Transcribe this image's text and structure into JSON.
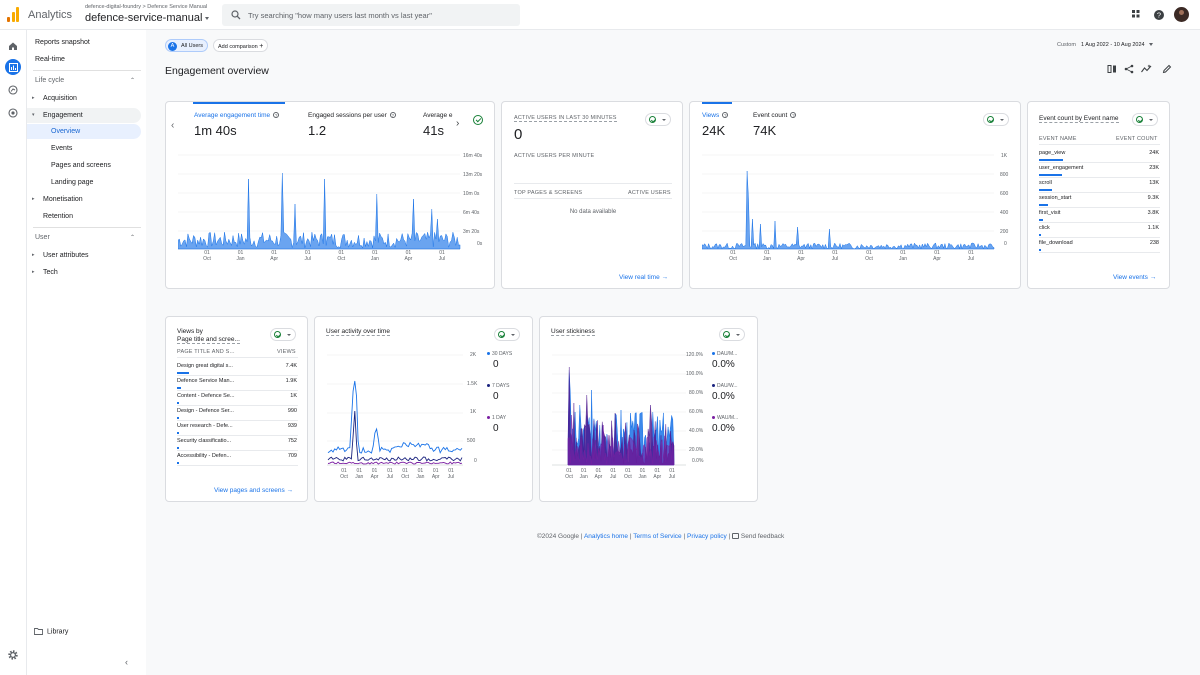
{
  "brand": {
    "app_name": "Analytics",
    "breadcrumb": "defence-digital-foundry  >  Defence Service Manual",
    "property": "defence-service-manual"
  },
  "search": {
    "placeholder": "Try searching \"how many users last month vs last year\""
  },
  "sidebar": {
    "reports_snapshot": "Reports snapshot",
    "realtime": "Real-time",
    "lifecycle_label": "Life cycle",
    "acquisition": "Acquisition",
    "engagement": "Engagement",
    "overview": "Overview",
    "events": "Events",
    "pages_screens": "Pages and screens",
    "landing_page": "Landing page",
    "monetisation": "Monetisation",
    "retention": "Retention",
    "user_label": "User",
    "user_attributes": "User attributes",
    "tech": "Tech",
    "library": "Library"
  },
  "toolbar": {
    "all_users": "All Users",
    "add_comparison": "Add comparison",
    "date_label": "Custom",
    "date_range": "1 Aug 2022 - 10 Aug 2024"
  },
  "page": {
    "title": "Engagement overview"
  },
  "main_card": {
    "metrics": [
      {
        "label": "Average engagement time",
        "value": "1m 40s"
      },
      {
        "label": "Engaged sessions per user",
        "value": "1.2"
      },
      {
        "label": "Average e",
        "value": "41s"
      }
    ],
    "y_ticks": [
      "16m 40s",
      "13m 20s",
      "10m 0s",
      "6m 40s",
      "3m 20s",
      "0s"
    ],
    "x_ticks": [
      [
        "01",
        "Oct"
      ],
      [
        "01",
        "Jan"
      ],
      [
        "01",
        "Apr"
      ],
      [
        "01",
        "Jul"
      ],
      [
        "01",
        "Oct"
      ],
      [
        "01",
        "Jan"
      ],
      [
        "01",
        "Apr"
      ],
      [
        "01",
        "Jul"
      ]
    ]
  },
  "realtime_card": {
    "title": "ACTIVE USERS IN LAST 30 MINUTES",
    "value": "0",
    "per_minute": "ACTIVE USERS PER MINUTE",
    "col1": "TOP PAGES & SCREENS",
    "col2": "ACTIVE USERS",
    "empty": "No data available",
    "link": "View real time"
  },
  "views_card": {
    "metrics": [
      {
        "label": "Views",
        "value": "24K"
      },
      {
        "label": "Event count",
        "value": "74K"
      }
    ],
    "y_ticks": [
      "1K",
      "800",
      "600",
      "400",
      "200",
      "0"
    ]
  },
  "events_card": {
    "title": "Event count by Event name",
    "col1": "EVENT NAME",
    "col2": "EVENT COUNT",
    "rows": [
      {
        "name": "page_view",
        "value": "24K"
      },
      {
        "name": "user_engagement",
        "value": "23K"
      },
      {
        "name": "scroll",
        "value": "13K"
      },
      {
        "name": "session_start",
        "value": "9.3K"
      },
      {
        "name": "first_visit",
        "value": "3.8K"
      },
      {
        "name": "click",
        "value": "1.1K"
      },
      {
        "name": "file_download",
        "value": "238"
      }
    ],
    "link": "View events"
  },
  "pages_card": {
    "title_line1": "Views by",
    "title_line2": "Page title and scree...",
    "col1": "PAGE TITLE AND S...",
    "col2": "VIEWS",
    "rows": [
      {
        "name": "Design great digital s...",
        "value": "7.4K"
      },
      {
        "name": "Defence Service Man...",
        "value": "1.9K"
      },
      {
        "name": "Content - Defence Se...",
        "value": "1K"
      },
      {
        "name": "Design - Defence Ser...",
        "value": "990"
      },
      {
        "name": "User research - Defe...",
        "value": "939"
      },
      {
        "name": "Security classificatio...",
        "value": "752"
      },
      {
        "name": "Accessibility - Defen...",
        "value": "709"
      }
    ],
    "link": "View pages and screens"
  },
  "activity_card": {
    "title": "User activity over time",
    "y_ticks": [
      "2K",
      "1.5K",
      "1K",
      "500",
      "0"
    ],
    "legend": [
      {
        "label": "30 DAYS",
        "value": "0"
      },
      {
        "label": "7 DAYS",
        "value": "0"
      },
      {
        "label": "1 DAY",
        "value": "0"
      }
    ]
  },
  "stickiness_card": {
    "title": "User stickiness",
    "y_ticks": [
      "120.0%",
      "100.0%",
      "80.0%",
      "60.0%",
      "40.0%",
      "20.0%",
      "0.0%"
    ],
    "legend": [
      {
        "label": "DAU/M...",
        "value": "0.0%"
      },
      {
        "label": "DAU/W...",
        "value": "0.0%"
      },
      {
        "label": "WAU/M...",
        "value": "0.0%"
      }
    ]
  },
  "footer": {
    "copyright": "©2024 Google |",
    "analytics_home": "Analytics home",
    "terms": "Terms of Service",
    "privacy": "Privacy policy",
    "sep": "|",
    "feedback": "Send feedback"
  },
  "colors": {
    "accent": "#1a73e8",
    "series_30d": "#1a73e8",
    "series_7d": "#1a237e",
    "series_1d": "#7b1fa2",
    "logo": "#f9ab00"
  }
}
